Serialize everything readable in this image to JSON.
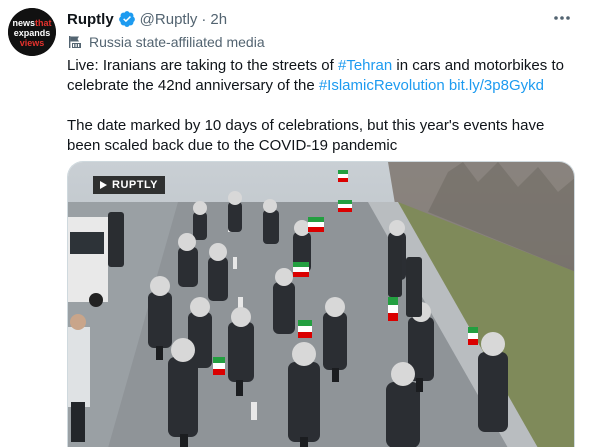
{
  "account": {
    "avatar_text": "newsthat expands views",
    "name": "Ruptly",
    "handle": "@Ruptly",
    "separator": "·",
    "time": "2h",
    "label": "Russia state-affiliated media"
  },
  "tweet": {
    "line1_prefix": "Live: Iranians are taking to the streets of ",
    "hashtag_tehran": "#Tehran",
    "line1_mid": " in cars and motorbikes to celebrate the 42nd anniversary of the ",
    "hashtag_revolution": "#IslamicRevolution",
    "space": " ",
    "link": "bit.ly/3p8Gykd",
    "paragraph2": "The date marked by 10 days of celebrations, but this year's events have been scaled back due to the COVID-19 pandemic"
  },
  "media": {
    "badge": "RUPTLY"
  },
  "icons": {
    "verified": "verified-badge-icon",
    "label": "government-building-icon",
    "more": "more-options-icon"
  },
  "colors": {
    "link": "#1d9bf0",
    "secondary_text": "#536471",
    "primary_text": "#0f1419"
  }
}
